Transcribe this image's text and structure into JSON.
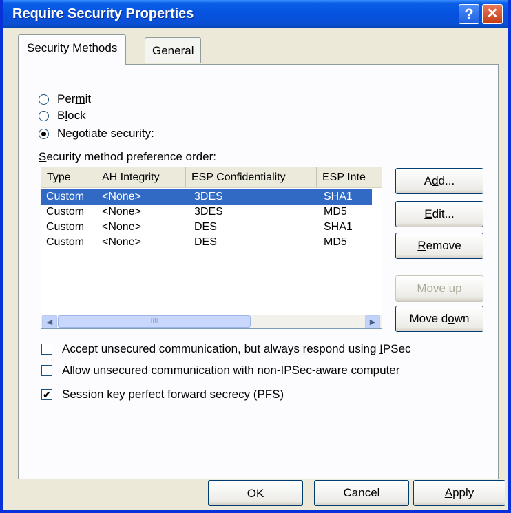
{
  "window": {
    "title": "Require Security Properties",
    "help_glyph": "?",
    "close_glyph": "✕"
  },
  "tabs": [
    {
      "label": "Security Methods",
      "active": true
    },
    {
      "label": "General",
      "active": false
    }
  ],
  "actions": {
    "permit": {
      "pre": "Per",
      "key": "m",
      "post": "it",
      "selected": false
    },
    "block": {
      "pre": "B",
      "key": "l",
      "post": "ock",
      "selected": false
    },
    "negotiate": {
      "pre": "",
      "key": "N",
      "post": "egotiate security:",
      "selected": true
    }
  },
  "preference_label": {
    "key": "S",
    "post": "ecurity method preference order:"
  },
  "table": {
    "columns": [
      "Type",
      "AH Integrity",
      "ESP Confidentiality",
      "ESP Inte"
    ],
    "rows": [
      {
        "type": "Custom",
        "ah": "<None>",
        "esp_conf": "3DES",
        "esp_int": "SHA1",
        "selected": true
      },
      {
        "type": "Custom",
        "ah": "<None>",
        "esp_conf": "3DES",
        "esp_int": "MD5",
        "selected": false
      },
      {
        "type": "Custom",
        "ah": "<None>",
        "esp_conf": "DES",
        "esp_int": "SHA1",
        "selected": false
      },
      {
        "type": "Custom",
        "ah": "<None>",
        "esp_conf": "DES",
        "esp_int": "MD5",
        "selected": false
      }
    ],
    "scroll_left": "◀",
    "scroll_right": "▶",
    "thumb_grip": "IIII"
  },
  "side_buttons": {
    "add": {
      "pre": "A",
      "key": "d",
      "post": "d..."
    },
    "edit": {
      "pre": "",
      "key": "E",
      "post": "dit..."
    },
    "remove": {
      "pre": "",
      "key": "R",
      "post": "emove"
    },
    "move_up": {
      "pre": "Move ",
      "key": "u",
      "post": "p",
      "enabled": false
    },
    "move_down": {
      "pre": "Move d",
      "key": "o",
      "post": "wn",
      "enabled": true
    }
  },
  "checkboxes": {
    "accept_unsecured": {
      "pre": "Accept unsecured communication, but always respond using ",
      "key": "I",
      "post": "PSec",
      "checked": false
    },
    "allow_unsecured": {
      "pre": "Allow unsecured communication ",
      "key": "w",
      "post": "ith non-IPSec-aware computer",
      "checked": false
    },
    "pfs": {
      "pre": "Session key ",
      "key": "p",
      "post": "erfect forward secrecy (PFS)",
      "checked": true,
      "mark": "✔"
    }
  },
  "footer": {
    "ok": "OK",
    "cancel": "Cancel",
    "apply": {
      "key": "A",
      "post": "pply"
    }
  }
}
